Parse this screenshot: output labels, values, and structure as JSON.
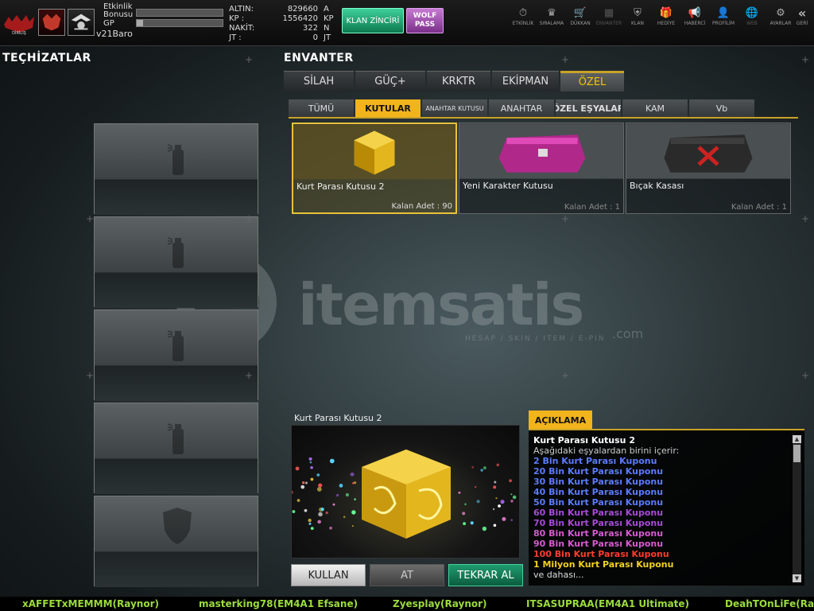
{
  "topbar": {
    "etkinlik_label": "Etkinlik\nBonusu",
    "gp_label": "GP",
    "username": "v21Baro",
    "etkinlik_fill": 0.0,
    "gp_fill": 0.07,
    "currencies": [
      {
        "label": "ALTIN:",
        "value": "829660",
        "unit": "A"
      },
      {
        "label": "KP  :",
        "value": "1556420",
        "unit": "KP"
      },
      {
        "label": "NAKİT:",
        "value": "322",
        "unit": "N"
      },
      {
        "label": "JT  :",
        "value": "0",
        "unit": "JT"
      }
    ],
    "klan_button": "KLAN ZİNCİRİ",
    "wolf_pass": "WOLF PASS",
    "icons": [
      {
        "name": "etkinlik",
        "label": "ETKİNLİK",
        "glyph": "⏱",
        "active": true
      },
      {
        "name": "siralama",
        "label": "SIRALAMA",
        "glyph": "♛",
        "active": true
      },
      {
        "name": "dukkan",
        "label": "DÜKKAN",
        "glyph": "🛒",
        "active": true
      },
      {
        "name": "envanter",
        "label": "ENVANTER",
        "glyph": "▦",
        "active": false
      },
      {
        "name": "klan",
        "label": "KLAN",
        "glyph": "⛨",
        "active": true
      },
      {
        "name": "hediye",
        "label": "HEDİYE",
        "glyph": "🎁",
        "active": true
      },
      {
        "name": "haberci",
        "label": "HABERCİ",
        "glyph": "📢",
        "active": true
      },
      {
        "name": "profilim",
        "label": "PROFİLİM",
        "glyph": "👤",
        "active": true
      },
      {
        "name": "web",
        "label": "WEB",
        "glyph": "🌐",
        "active": false
      },
      {
        "name": "ayarlar",
        "label": "AYARLAR",
        "glyph": "⚙",
        "active": true
      }
    ],
    "geri": {
      "label": "GERİ",
      "glyph": "«"
    }
  },
  "left": {
    "title": "TEÇHİZATLAR",
    "slots": [
      {
        "type": "spray"
      },
      {
        "type": "spray"
      },
      {
        "type": "spray"
      },
      {
        "type": "spray"
      },
      {
        "type": "shield"
      }
    ]
  },
  "inventory": {
    "title": "ENVANTER",
    "tabs": [
      "SİLAH",
      "GÜÇ+",
      "KRKTR",
      "EKİPMAN",
      "ÖZEL"
    ],
    "active_tab": 4,
    "subtabs": [
      "TÜMÜ",
      "KUTULAR",
      "ANAHTAR KUTUSU",
      "ANAHTAR",
      "ÖZEL EŞYALAR",
      "KAM",
      "Vb"
    ],
    "active_subtab": 1,
    "items": [
      {
        "name": "Kurt Parası Kutusu 2",
        "count": "Kalan Adet : 90",
        "selected": true,
        "kind": "gold"
      },
      {
        "name": "Yeni Karakter Kutusu",
        "count": "Kalan Adet : 1",
        "selected": false,
        "kind": "pink"
      },
      {
        "name": "Bıçak Kasası",
        "count": "Kalan Adet : 1",
        "selected": false,
        "kind": "black"
      }
    ]
  },
  "preview": {
    "title": "Kurt Parası Kutusu 2",
    "buttons": {
      "use": "KULLAN",
      "drop": "AT",
      "rebuy": "TEKRAR AL"
    }
  },
  "description": {
    "tab": "AÇIKLAMA",
    "title": "Kurt Parası Kutusu 2",
    "subtitle": "Aşağıdaki eşyalardan birini içerir:",
    "lines": [
      {
        "text": "2 Bin Kurt Parası Kuponu",
        "color": "#5b7bff"
      },
      {
        "text": "20 Bin Kurt Parası Kuponu",
        "color": "#5b7bff"
      },
      {
        "text": "30 Bin Kurt Parası Kuponu",
        "color": "#5b7bff"
      },
      {
        "text": "40 Bin Kurt Parası Kuponu",
        "color": "#5b7bff"
      },
      {
        "text": "50 Bin Kurt Parası Kuponu",
        "color": "#5b7bff"
      },
      {
        "text": "60 Bin Kurt Parası Kuponu",
        "color": "#a64ad8"
      },
      {
        "text": "70 Bin Kurt Parası Kuponu",
        "color": "#a64ad8"
      },
      {
        "text": "80 Bin Kurt Parası Kuponu",
        "color": "#d85ad0"
      },
      {
        "text": "90 Bin Kurt Parası Kuponu",
        "color": "#d85ad0"
      },
      {
        "text": "100 Bin Kurt Parası Kuponu",
        "color": "#ff3b2f"
      },
      {
        "text": "1 Milyon Kurt Parası Kuponu",
        "color": "#f2d21c"
      },
      {
        "text": "ve dahası...",
        "color": "#dddddd"
      }
    ]
  },
  "chat": [
    "xAFFETxMEMMM(Raynor)",
    "masterking78(EM4A1 Efsane)",
    "Zyesplay(Raynor)",
    "ITSASUPRAA(EM4A1 Ultimate)",
    "DeahTOnLiFe(Ra"
  ],
  "watermark": {
    "brand": "itemsatis",
    "tagline": "HESAP / SKIN / ITEM / E-PIN",
    "domain": ".com"
  }
}
